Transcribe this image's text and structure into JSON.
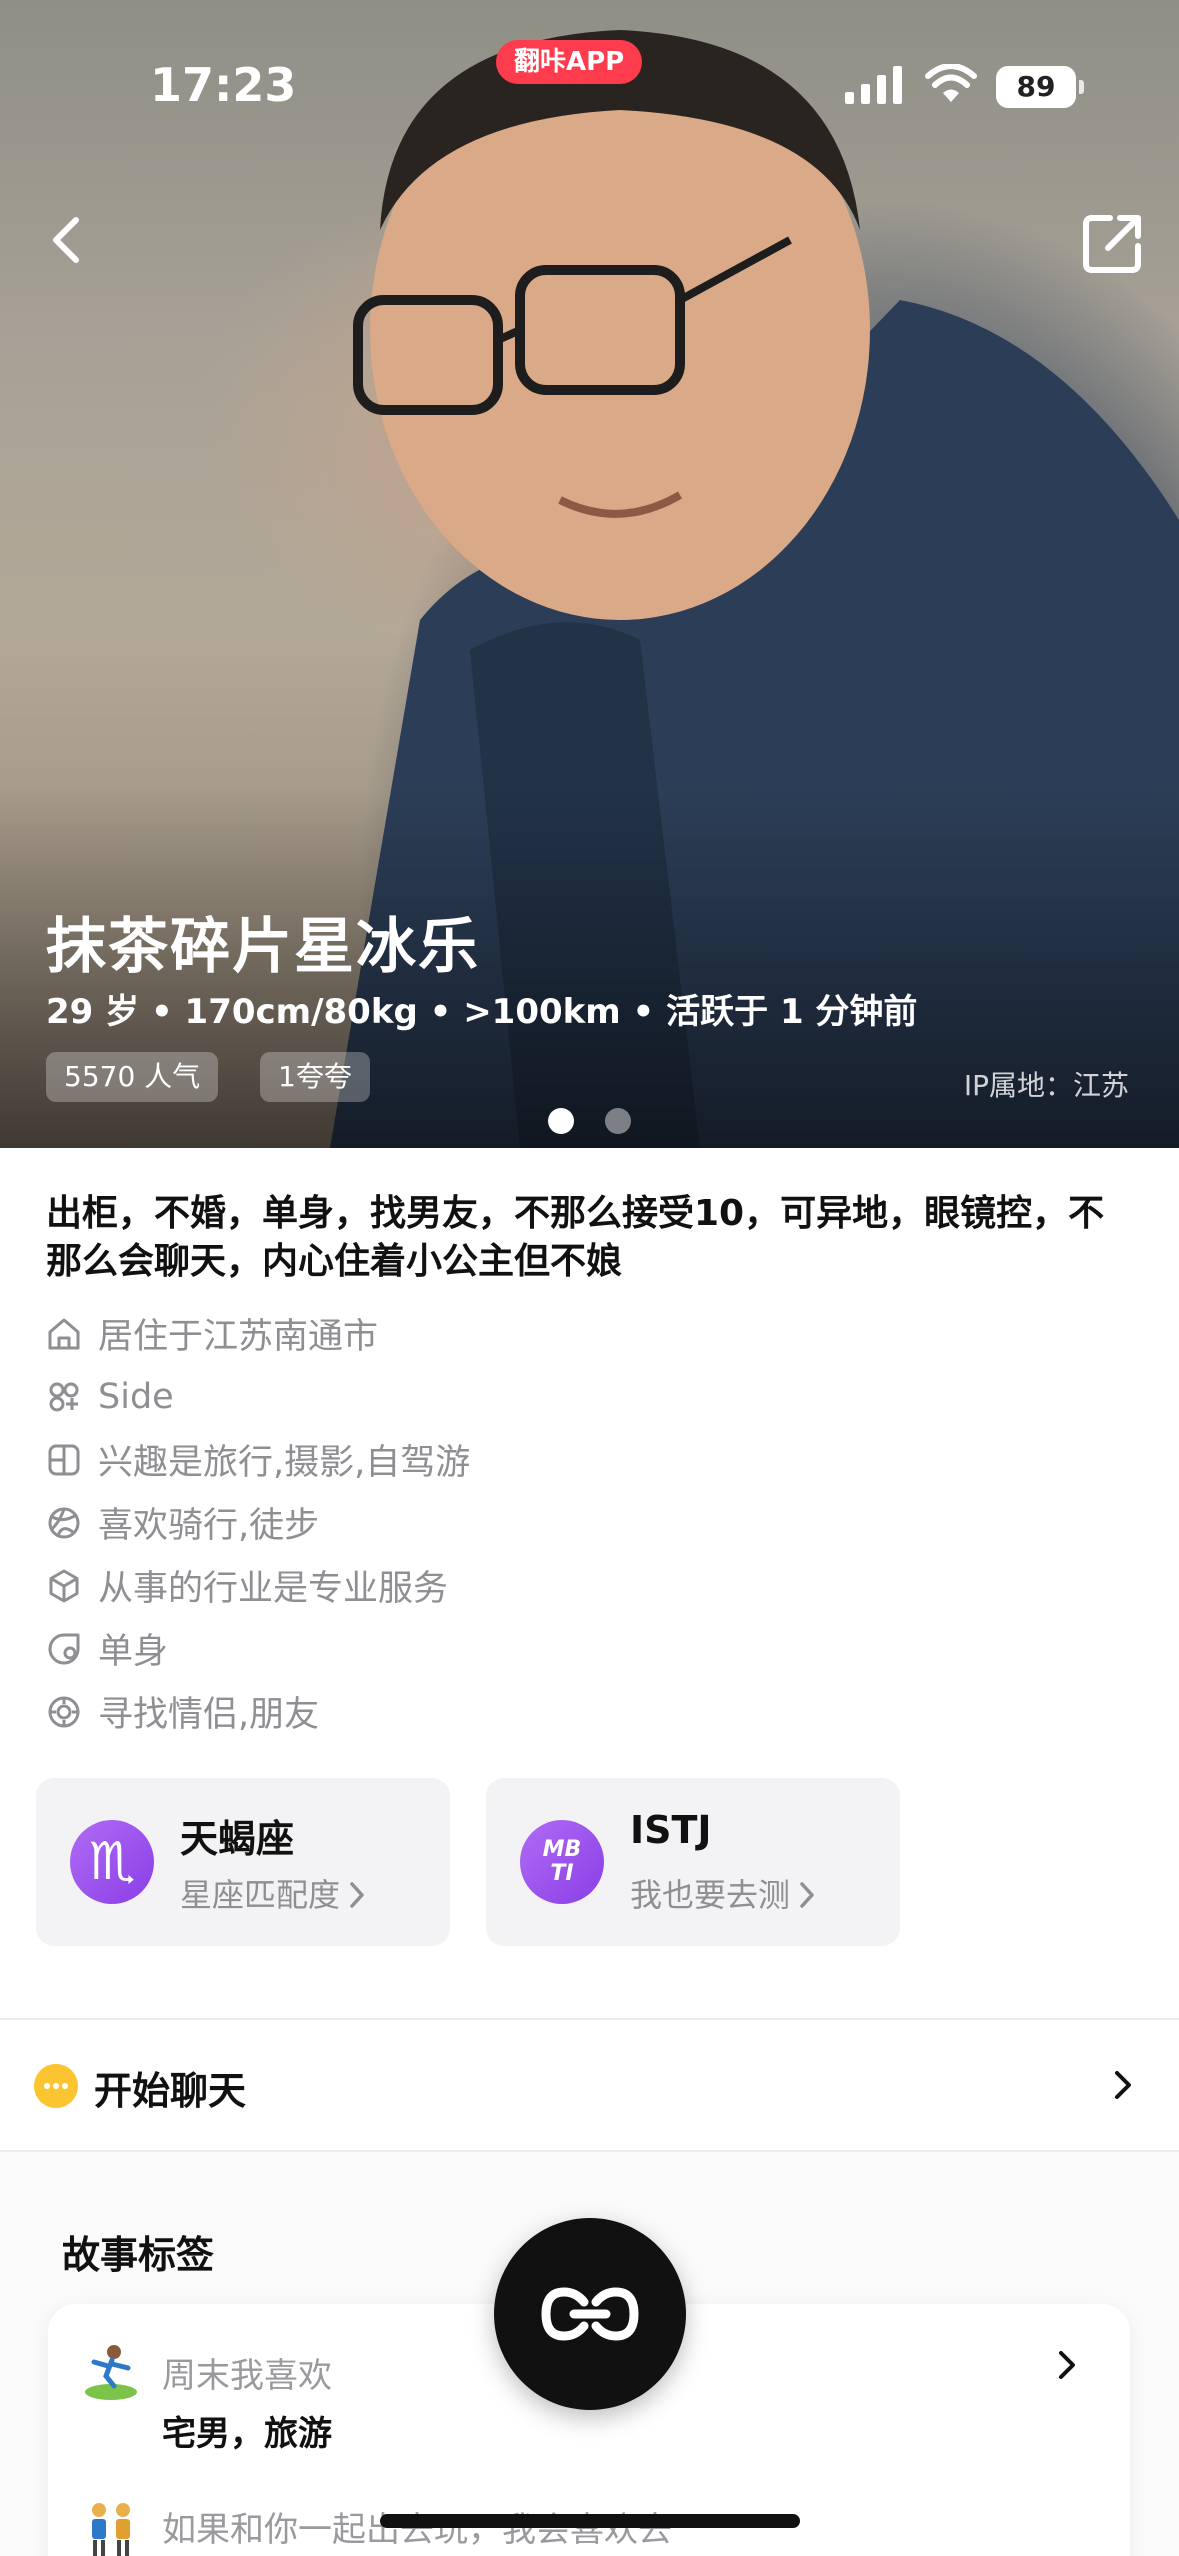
{
  "status_bar": {
    "time": "17:23",
    "app_badge": "翻咔APP",
    "battery": "89"
  },
  "profile": {
    "name": "抹茶碎片星冰乐",
    "meta": "29 岁 • 170cm/80kg • >100km • 活跃于 1 分钟前",
    "popularity": "5570 人气",
    "praise": "1夸夸",
    "ip_location": "IP属地：江苏",
    "photo_count": 2,
    "photo_index": 1
  },
  "bio": "出柜，不婚，单身，找男友，不那么接受10，可异地，眼镜控，不那么会聊天，内心住着小公主但不娘",
  "info_items": [
    {
      "icon": "home-icon",
      "text": "居住于江苏南通市"
    },
    {
      "icon": "role-icon",
      "text": "Side"
    },
    {
      "icon": "interest-icon",
      "text": "兴趣是旅行,摄影,自驾游"
    },
    {
      "icon": "sport-icon",
      "text": "喜欢骑行,徒步"
    },
    {
      "icon": "industry-icon",
      "text": "从事的行业是专业服务"
    },
    {
      "icon": "relationship-icon",
      "text": "单身"
    },
    {
      "icon": "target-icon",
      "text": "寻找情侣,朋友"
    }
  ],
  "cards": {
    "zodiac": {
      "symbol": "♏",
      "title": "天蝎座",
      "sub": "星座匹配度"
    },
    "mbti": {
      "symbol_top": "MB",
      "symbol_bottom": "TI",
      "title": "ISTJ",
      "sub": "我也要去测"
    }
  },
  "chat": {
    "label": "开始聊天"
  },
  "story": {
    "title": "故事标签",
    "items": [
      {
        "emoji": "surfer-emoji",
        "question": "周末我喜欢",
        "answer": "宅男，旅游"
      },
      {
        "emoji": "couple-emoji",
        "question": "如果和你一起出去玩，我会喜欢去",
        "answer": ""
      }
    ]
  },
  "colors": {
    "accent_purple": "#9b51e0",
    "chat_yellow": "#fbc531",
    "app_badge_red": "#ff3b4e"
  }
}
